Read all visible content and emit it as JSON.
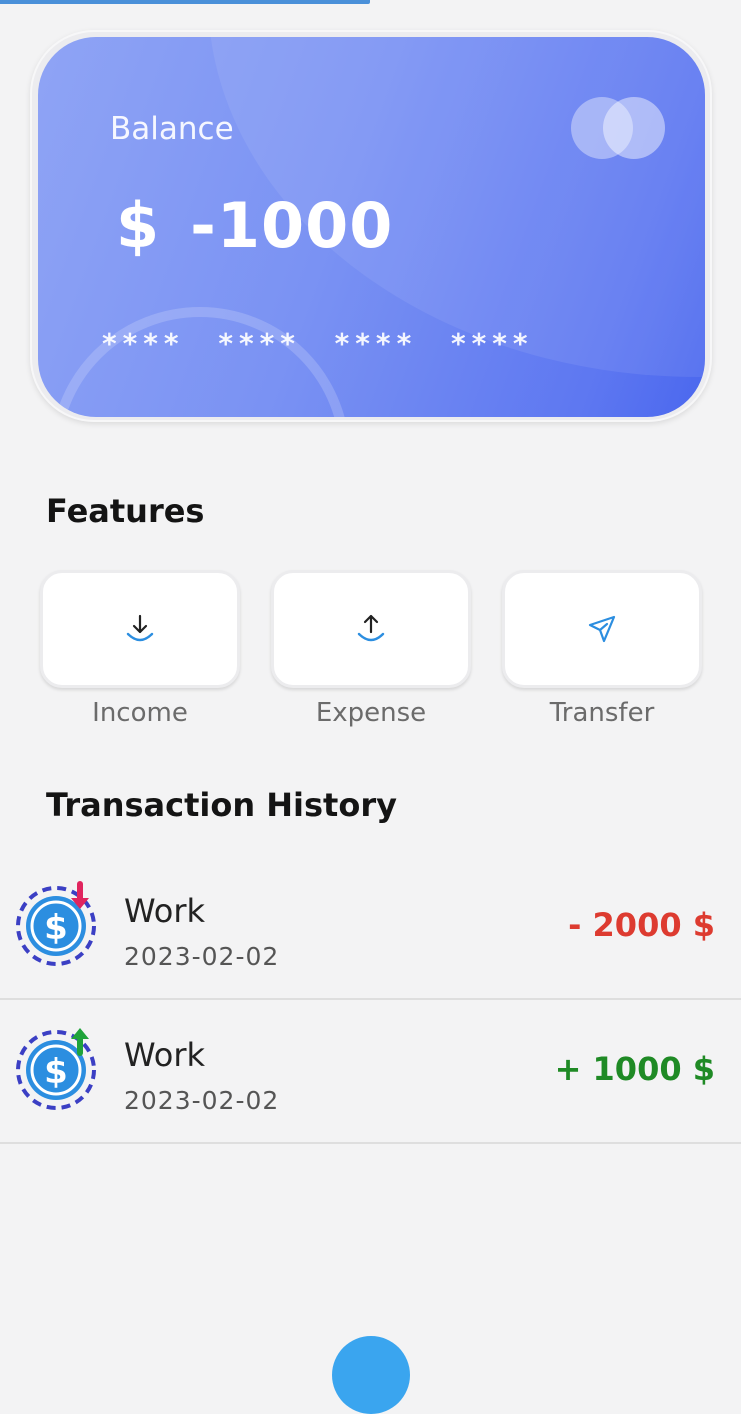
{
  "card": {
    "label": "Balance",
    "currency": "$",
    "amount": "-1000",
    "masked_number": "**** **** **** ****"
  },
  "features": {
    "title": "Features",
    "items": [
      {
        "label": "Income",
        "icon": "download-arrow-icon"
      },
      {
        "label": "Expense",
        "icon": "upload-arrow-icon"
      },
      {
        "label": "Transfer",
        "icon": "send-icon"
      }
    ]
  },
  "history": {
    "title": "Transaction History",
    "transactions": [
      {
        "name": "Work",
        "date": "2023-02-02",
        "amount": "- 2000  $",
        "type": "expense",
        "icon": "dollar-down-icon"
      },
      {
        "name": "Work",
        "date": "2023-02-02",
        "amount": "+ 1000  $",
        "type": "income",
        "icon": "dollar-up-icon"
      }
    ]
  },
  "colors": {
    "accent": "#4a90d9",
    "card_gradient_start": "#8fa4f5",
    "card_gradient_end": "#4a67ee",
    "expense": "#dd3b30",
    "income": "#1f8a25",
    "icon_blue": "#2c8ee0"
  }
}
